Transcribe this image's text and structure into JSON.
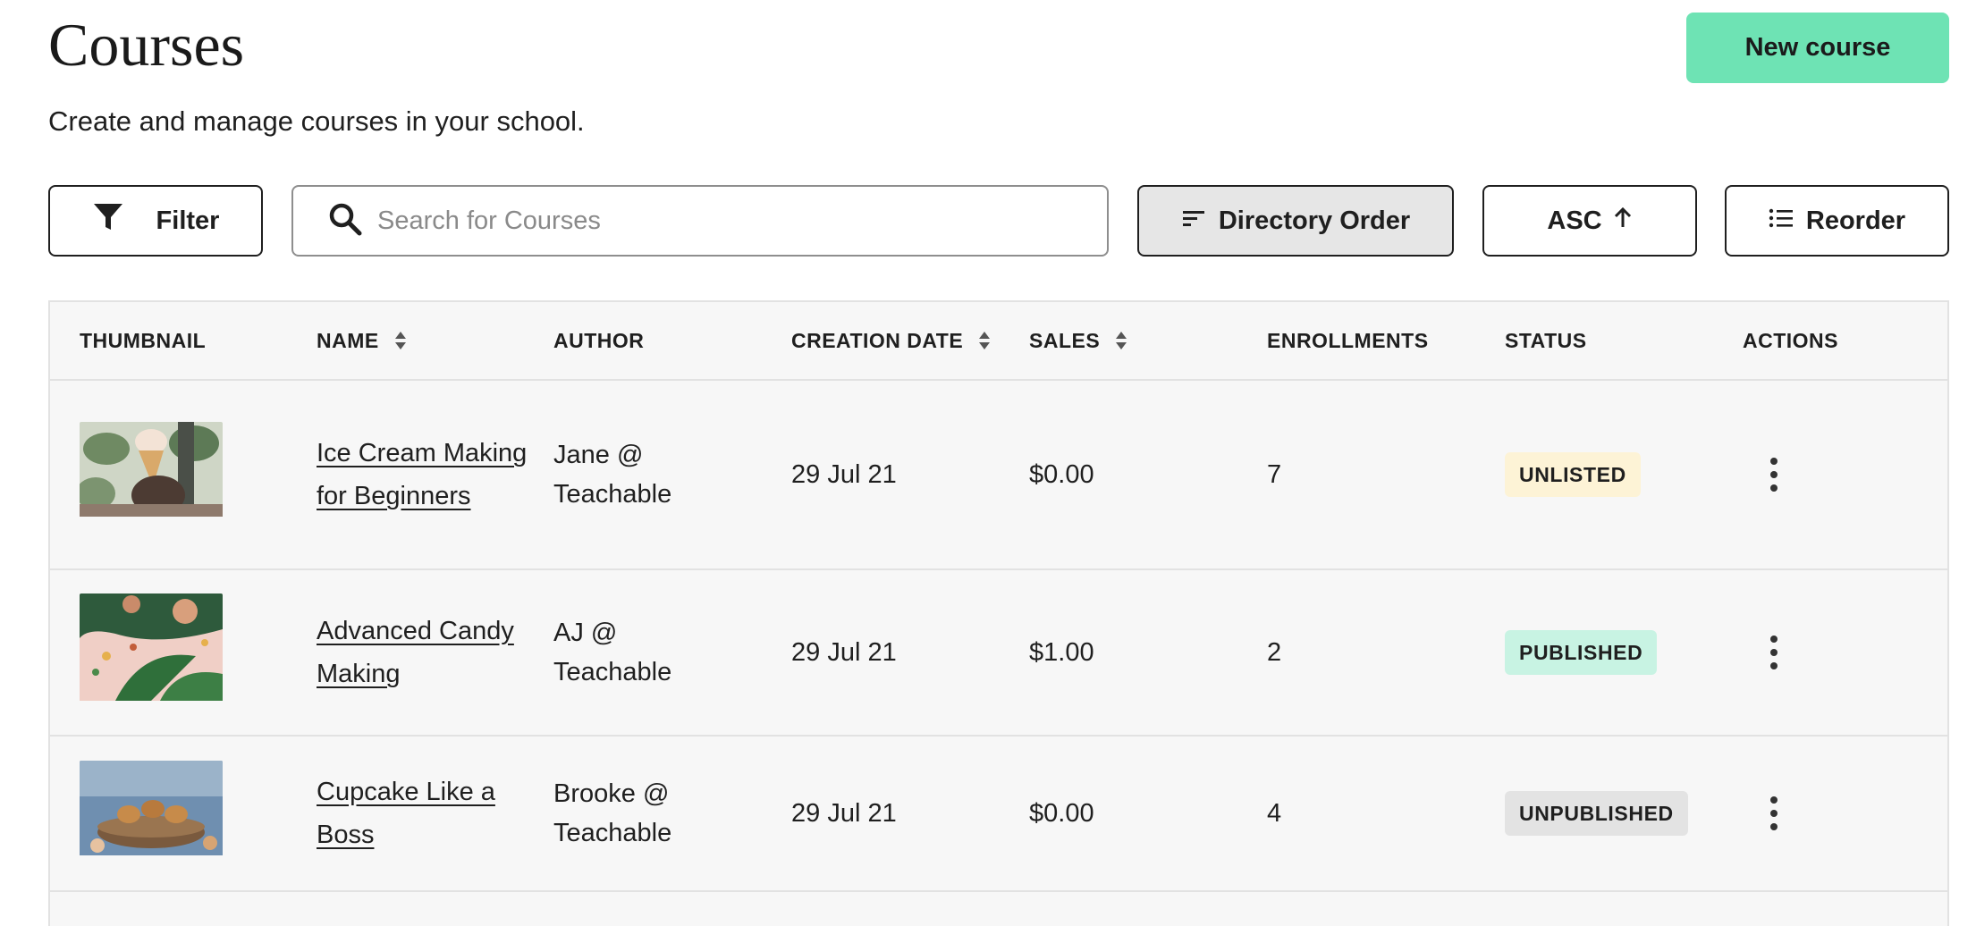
{
  "header": {
    "title": "Courses",
    "subtitle": "Create and manage courses in your school.",
    "new_course_label": "New course"
  },
  "toolbar": {
    "filter_label": "Filter",
    "search_placeholder": "Search for Courses",
    "search_value": "",
    "order_label": "Directory Order",
    "direction_label": "ASC",
    "reorder_label": "Reorder"
  },
  "table": {
    "columns": {
      "thumbnail": "THUMBNAIL",
      "name": "NAME",
      "author": "AUTHOR",
      "creation_date": "CREATION DATE",
      "sales": "SALES",
      "enrollments": "ENROLLMENTS",
      "status": "STATUS",
      "actions": "ACTIONS"
    },
    "rows": [
      {
        "name": "Ice Cream Making for Beginners",
        "author_line1": "Jane @",
        "author_line2": "Teachable",
        "creation_date": "29 Jul 21",
        "sales": "$0.00",
        "enrollments": "7",
        "status": "UNLISTED"
      },
      {
        "name": "Advanced Candy Making",
        "author_line1": "AJ @",
        "author_line2": "Teachable",
        "creation_date": "29 Jul 21",
        "sales": "$1.00",
        "enrollments": "2",
        "status": "PUBLISHED"
      },
      {
        "name": "Cupcake Like a Boss",
        "author_line1": "Brooke @",
        "author_line2": "Teachable",
        "creation_date": "29 Jul 21",
        "sales": "$0.00",
        "enrollments": "4",
        "status": "UNPUBLISHED"
      }
    ]
  },
  "colors": {
    "accent": "#6ee3b4",
    "unlisted_bg": "#fdf3d6",
    "published_bg": "#c8f3e3",
    "unpublished_bg": "#e3e3e3"
  },
  "icons": {
    "filter": "filter-funnel-icon",
    "search": "search-icon",
    "order": "sort-lines-icon",
    "direction": "arrow-up-icon",
    "reorder": "list-icon",
    "actions": "kebab-menu-icon"
  }
}
